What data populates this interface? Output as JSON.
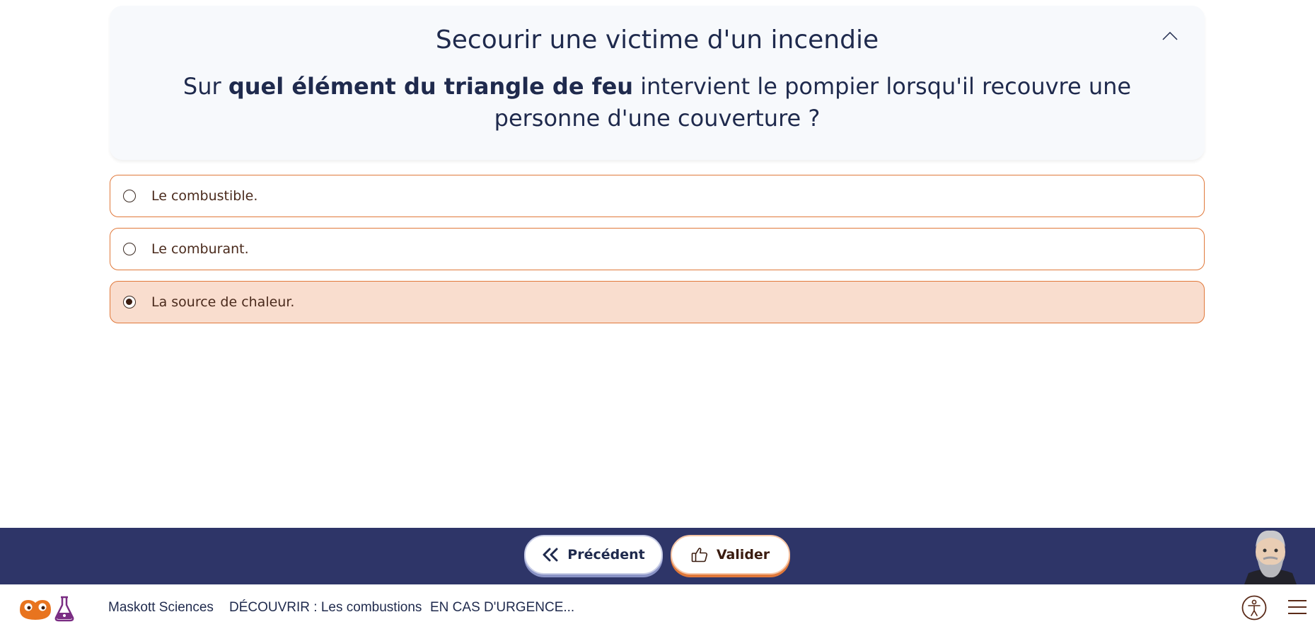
{
  "question": {
    "title": "Secourir une victime d'un incendie",
    "text_before": "Sur ",
    "text_bold": "quel élément du triangle de feu",
    "text_after": " intervient le pompier lorsqu'il recouvre une personne d'une couverture ?"
  },
  "options": [
    {
      "label": "Le combustible.",
      "selected": false
    },
    {
      "label": "Le comburant.",
      "selected": false
    },
    {
      "label": "La source de chaleur.",
      "selected": true
    }
  ],
  "nav": {
    "prev_label": "Précédent",
    "valid_label": "Valider"
  },
  "footer": {
    "crumb1": "Maskott Sciences",
    "crumb2": "DÉCOUVRIR : Les combustions",
    "crumb3": "EN CAS D'URGENCE..."
  },
  "colors": {
    "accent": "#e0783a",
    "navbar": "#2e3568",
    "selected_bg": "#f9ddce",
    "text": "#1f2a4d"
  },
  "icons": [
    "chevron-up-icon",
    "double-chevron-left-icon",
    "thumbs-up-icon",
    "accessibility-icon",
    "hamburger-menu-icon"
  ]
}
